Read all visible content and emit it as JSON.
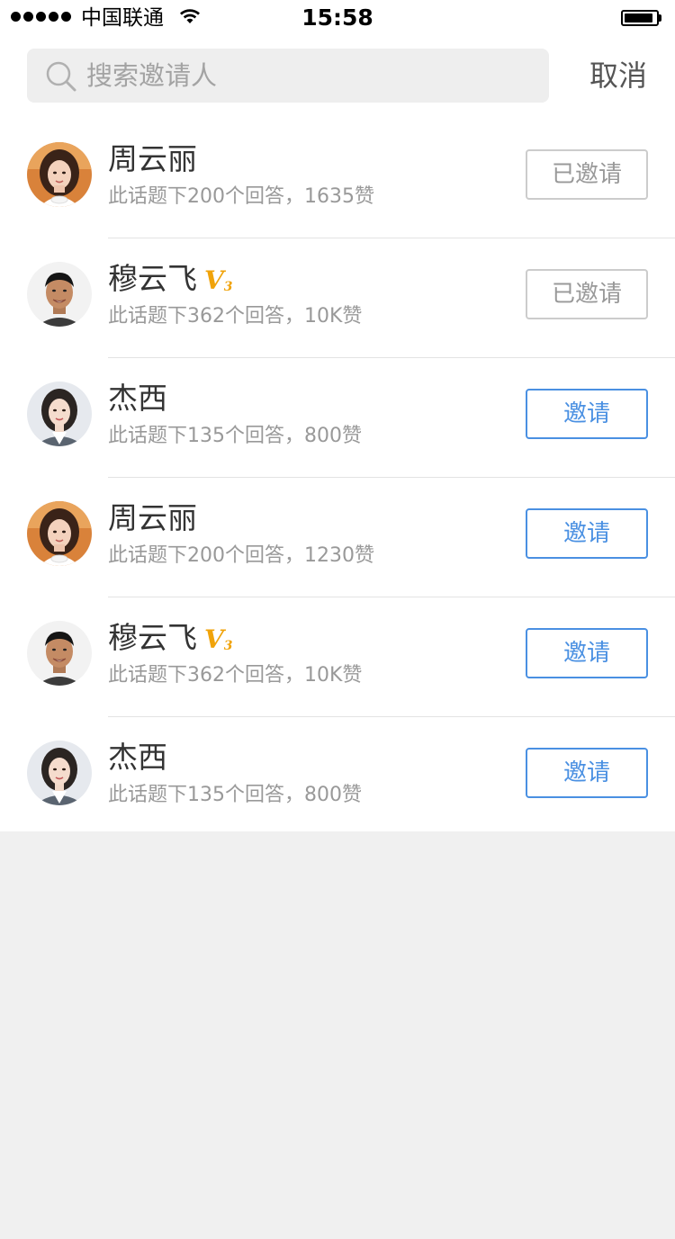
{
  "status_bar": {
    "carrier": "中国联通",
    "time": "15:58",
    "battery_level": 0.9
  },
  "search": {
    "placeholder": "搜索邀请人",
    "value": "",
    "cancel_label": "取消"
  },
  "users": [
    {
      "name": "周云丽",
      "badge": "",
      "badge_level": "",
      "stats": "此话题下200个回答，1635赞",
      "button_label": "已邀请",
      "invited": true,
      "avatar": "woman-warm"
    },
    {
      "name": "穆云飞",
      "badge": "V",
      "badge_level": "3",
      "stats": "此话题下362个回答，10K赞",
      "button_label": "已邀请",
      "invited": true,
      "avatar": "man"
    },
    {
      "name": "杰西",
      "badge": "",
      "badge_level": "",
      "stats": "此话题下135个回答，800赞",
      "button_label": "邀请",
      "invited": false,
      "avatar": "woman-suit"
    },
    {
      "name": "周云丽",
      "badge": "",
      "badge_level": "",
      "stats": "此话题下200个回答，1230赞",
      "button_label": "邀请",
      "invited": false,
      "avatar": "woman-warm"
    },
    {
      "name": "穆云飞",
      "badge": "V",
      "badge_level": "3",
      "stats": "此话题下362个回答，10K赞",
      "button_label": "邀请",
      "invited": false,
      "avatar": "man"
    },
    {
      "name": "杰西",
      "badge": "",
      "badge_level": "",
      "stats": "此话题下135个回答，800赞",
      "button_label": "邀请",
      "invited": false,
      "avatar": "woman-suit"
    }
  ],
  "colors": {
    "accent": "#4a90e2",
    "badge": "#f0a30a",
    "muted": "#999999",
    "background": "#f0f0f0"
  }
}
